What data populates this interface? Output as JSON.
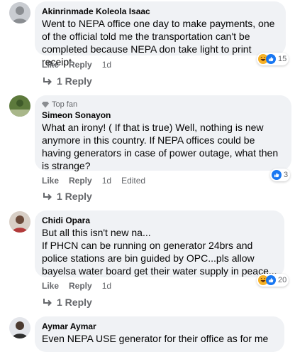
{
  "comments": [
    {
      "author": "Akinrinmade Koleola Isaac",
      "text": "Went to NEPA office one day to make payments, one of the official told me the transportation can't be completed because NEPA don take light to print receipt",
      "like": "Like",
      "reply": "Reply",
      "time": "1d",
      "reaction_count": "15",
      "replies_label": "1 Reply"
    },
    {
      "badge": "Top fan",
      "author": "Simeon Sonayon",
      "text": "What an irony! ( If that is true) Well, nothing is new anymore in this country. If NEPA offices could be having generators in case of power outage, what then is strange?",
      "like": "Like",
      "reply": "Reply",
      "time": "1d",
      "edited": "Edited",
      "reaction_count": "3",
      "replies_label": "1 Reply"
    },
    {
      "author": "Chidi Opara",
      "text": "But all this isn't new na...\nIf PHCN can be running on generator 24brs and police stations are bin guided by OPC...pls allow bayelsa water board get their water supply in peace...",
      "like": "Like",
      "reply": "Reply",
      "time": "1d",
      "reaction_count": "20",
      "replies_label": "1 Reply"
    },
    {
      "author": "Aymar Aymar",
      "text": "Even NEPA USE generator for their office as for me"
    }
  ],
  "colors": {
    "bubble": "#f0f2f5",
    "secondary_text": "#65676b",
    "like_blue": "#1877f2",
    "haha_yellow": "#f7b125"
  }
}
